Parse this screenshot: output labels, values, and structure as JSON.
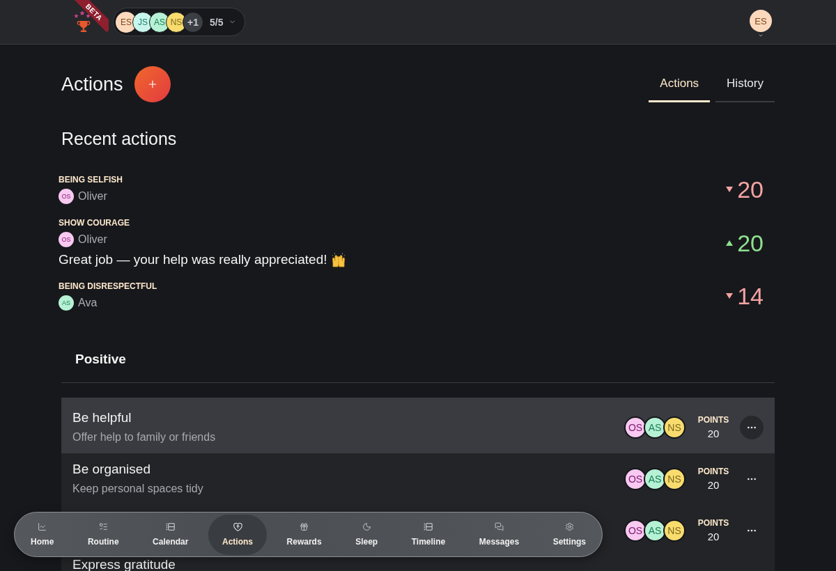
{
  "header": {
    "logo": {
      "badge": "BETA"
    },
    "members": {
      "avatars": [
        {
          "initials": "ES",
          "color": "#fcd9bd"
        },
        {
          "initials": "JS",
          "color": "#c9f6ec"
        },
        {
          "initials": "AS",
          "color": "#b6f1d6"
        },
        {
          "initials": "NS",
          "color": "#f8dc6e"
        }
      ],
      "overflow": "+1",
      "count": "5/5"
    },
    "user": {
      "initials": "ES",
      "color": "#fcd9bd"
    }
  },
  "page": {
    "title": "Actions",
    "tabs": [
      {
        "label": "Actions",
        "selected": true
      },
      {
        "label": "History",
        "selected": false
      }
    ]
  },
  "recent": {
    "title": "Recent actions",
    "items": [
      {
        "label": "BEING SELFISH",
        "person": {
          "initials": "OS",
          "name": "Oliver",
          "color": "#f8c9f1"
        },
        "kind": "negative",
        "points": "20"
      },
      {
        "label": "SHOW COURAGE",
        "person": {
          "initials": "OS",
          "name": "Oliver",
          "color": "#f8c9f1"
        },
        "comment": "Great job — your help was really appreciated!",
        "kind": "positive",
        "points": "20"
      },
      {
        "label": "BEING DISRESPECTFUL",
        "person": {
          "initials": "AS",
          "name": "Ava",
          "color": "#b6f1d6"
        },
        "kind": "negative",
        "points": "14"
      }
    ]
  },
  "section": {
    "title": "Positive",
    "rows": [
      {
        "title": "Be helpful",
        "description": "Offer help to family or friends",
        "selected": true,
        "members": [
          {
            "initials": "OS",
            "color": "#f8c9f1"
          },
          {
            "initials": "AS",
            "color": "#b6f1d6"
          },
          {
            "initials": "NS",
            "color": "#f8dc6e"
          }
        ],
        "points_label": "POINTS",
        "points": "20"
      },
      {
        "title": "Be organised",
        "description": "Keep personal spaces tidy",
        "selected": false,
        "members": [
          {
            "initials": "OS",
            "color": "#f8c9f1"
          },
          {
            "initials": "AS",
            "color": "#b6f1d6"
          },
          {
            "initials": "NS",
            "color": "#f8dc6e"
          }
        ],
        "points_label": "POINTS",
        "points": "20"
      },
      {
        "selected": false,
        "members": [
          {
            "initials": "OS",
            "color": "#f8c9f1"
          },
          {
            "initials": "AS",
            "color": "#b6f1d6"
          },
          {
            "initials": "NS",
            "color": "#f8dc6e"
          }
        ],
        "points_label": "POINTS",
        "points": "20"
      },
      {
        "title": "Express gratitude",
        "selected": false
      }
    ]
  },
  "nav": {
    "items": [
      {
        "label": "Home",
        "selected": false
      },
      {
        "label": "Routine",
        "selected": false
      },
      {
        "label": "Calendar",
        "selected": false
      },
      {
        "label": "Actions",
        "selected": true
      },
      {
        "label": "Rewards",
        "selected": false
      },
      {
        "label": "Sleep",
        "selected": false
      },
      {
        "label": "Timeline",
        "selected": false
      },
      {
        "label": "Messages",
        "selected": false
      },
      {
        "label": "Settings",
        "selected": false
      }
    ]
  }
}
